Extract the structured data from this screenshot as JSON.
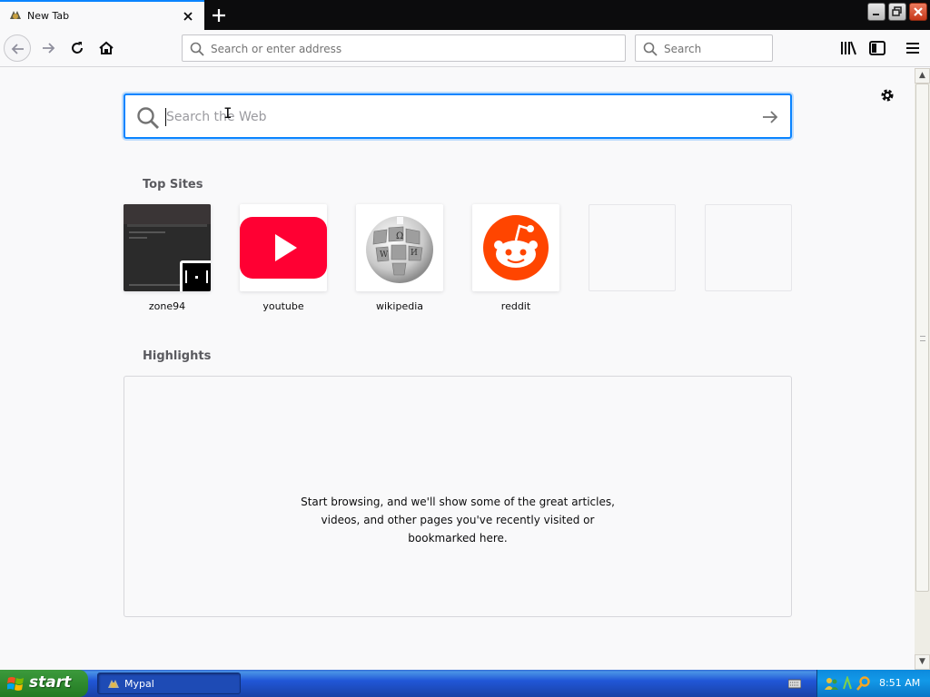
{
  "browser": {
    "tab": {
      "title": "New Tab"
    },
    "urlbar": {
      "placeholder": "Search or enter address"
    },
    "searchbar": {
      "placeholder": "Search"
    }
  },
  "newtab": {
    "web_search": {
      "placeholder": "Search the Web"
    },
    "top_sites": {
      "title": "Top Sites",
      "sites": [
        {
          "label": "zone94",
          "icon": "zone94-screenshot"
        },
        {
          "label": "youtube",
          "icon": "youtube-icon",
          "color": "#ff0033"
        },
        {
          "label": "wikipedia",
          "icon": "wikipedia-globe-icon"
        },
        {
          "label": "reddit",
          "icon": "reddit-icon",
          "color": "#ff4500"
        }
      ]
    },
    "highlights": {
      "title": "Highlights",
      "empty_message": "Start browsing, and we'll show some of the great articles,\nvideos, and other pages you've recently visited or\nbookmarked here."
    }
  },
  "taskbar": {
    "start_label": "start",
    "task_item": "Mypal",
    "clock": "8:51 AM"
  },
  "colors": {
    "accent": "#0a84ff",
    "taskbar": "#245edb",
    "start": "#3c9a3c"
  }
}
